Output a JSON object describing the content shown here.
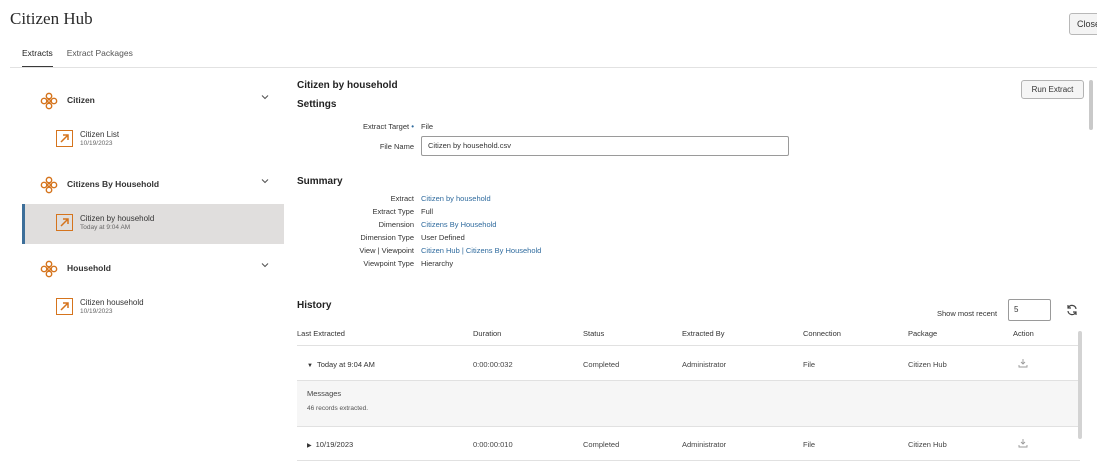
{
  "app": {
    "title": "Citizen Hub",
    "close_label": "Close"
  },
  "tabs": [
    {
      "label": "Extracts"
    },
    {
      "label": "Extract Packages"
    }
  ],
  "sidebar": {
    "groups": [
      {
        "label": "Citizen",
        "items": [
          {
            "name": "Citizen List",
            "date": "10/19/2023"
          }
        ]
      },
      {
        "label": "Citizens By Household",
        "items": [
          {
            "name": "Citizen by household",
            "date": "Today at 9:04 AM",
            "selected": true
          }
        ]
      },
      {
        "label": "Household",
        "items": [
          {
            "name": "Citizen household",
            "date": "10/19/2023"
          }
        ]
      }
    ]
  },
  "main": {
    "title": "Citizen by household",
    "run_label": "Run Extract",
    "settings": {
      "heading": "Settings",
      "extract_target_label": "Extract Target",
      "extract_target_value": "File",
      "file_name_label": "File Name",
      "file_name_value": "Citizen by household.csv"
    },
    "summary": {
      "heading": "Summary",
      "rows": [
        {
          "label": "Extract",
          "value": "Citizen by household",
          "link": true
        },
        {
          "label": "Extract Type",
          "value": "Full",
          "link": false
        },
        {
          "label": "Dimension",
          "value": "Citizens By Household",
          "link": true
        },
        {
          "label": "Dimension Type",
          "value": "User Defined",
          "link": false
        },
        {
          "label": "View | Viewpoint",
          "value": "Citizen Hub | Citizens By Household",
          "link": true
        },
        {
          "label": "Viewpoint Type",
          "value": "Hierarchy",
          "link": false
        }
      ]
    },
    "history": {
      "heading": "History",
      "show_recent_label": "Show most recent",
      "show_recent_value": "5",
      "columns": [
        "Last Extracted",
        "Duration",
        "Status",
        "Extracted By",
        "Connection",
        "Package",
        "Action"
      ],
      "rows": [
        {
          "last_extracted": "Today at 9:04 AM",
          "expanded": true,
          "duration": "0:00:00:032",
          "status": "Completed",
          "extracted_by": "Administrator",
          "connection": "File",
          "package": "Citizen Hub"
        },
        {
          "last_extracted": "10/19/2023",
          "expanded": false,
          "duration": "0:00:00:010",
          "status": "Completed",
          "extracted_by": "Administrator",
          "connection": "File",
          "package": "Citizen Hub"
        }
      ],
      "messages": {
        "title": "Messages",
        "text": "46 records extracted."
      }
    }
  },
  "colors": {
    "accent_orange": "#d5741d",
    "link_blue": "#2f6b9e",
    "selected_bg": "#e0dedd",
    "selected_border": "#3d6f9a"
  },
  "icons": {
    "group": "dimension-flower-icon",
    "item": "extract-arrow-icon",
    "chevron": "chevron-down-icon",
    "refresh": "refresh-icon",
    "download": "download-icon"
  }
}
